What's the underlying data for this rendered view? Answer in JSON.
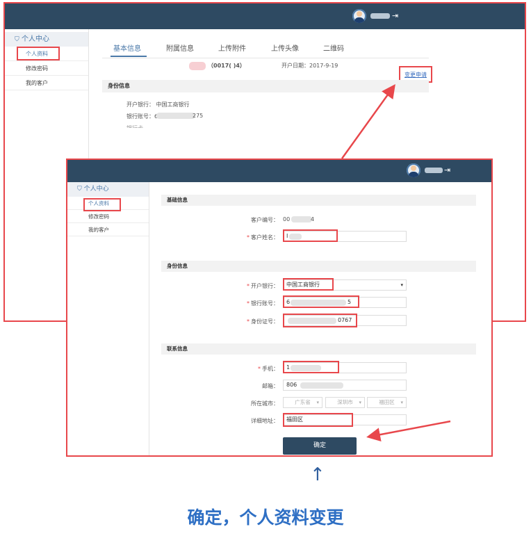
{
  "back_window": {
    "sidebar": {
      "section": "个人中心",
      "items": [
        {
          "label": "个人资料"
        },
        {
          "label": "修改密码"
        },
        {
          "label": "我的客户"
        }
      ]
    },
    "tabs": [
      {
        "label": "基本信息"
      },
      {
        "label": "附属信息"
      },
      {
        "label": "上传附件"
      },
      {
        "label": "上传头像"
      },
      {
        "label": "二维码"
      }
    ],
    "customer_code": "（0017(      )4）",
    "open_date": "开户日期：2017-9-19",
    "change_link": "变更申请",
    "section_title": "身份信息",
    "details": {
      "bank": "开户银行：  中国工商银行",
      "account_prefix": "银行账号：6",
      "account_suffix": "275",
      "truncated": "银行卡-"
    }
  },
  "front_window": {
    "sidebar": {
      "section": "个人中心",
      "items": [
        {
          "label": "个人资料"
        },
        {
          "label": "修改密码"
        },
        {
          "label": "我的客户"
        }
      ]
    },
    "sections": {
      "basic": "基础信息",
      "identity": "身份信息",
      "contact": "联系信息"
    },
    "form": {
      "customer_no_label": "客户编号：",
      "customer_no_prefix": "00",
      "customer_no_suffix": "4",
      "name_label": "客户姓名：",
      "name_value": "I",
      "bank_label": "开户银行：",
      "bank_value": "中国工商银行",
      "account_label": "银行账号：",
      "account_prefix": "6",
      "account_suffix": "5",
      "id_label": "身份证号：",
      "id_suffix": "0767",
      "phone_label": "手机：",
      "phone_prefix": "1",
      "email_label": "邮箱：",
      "email_prefix": "806",
      "city_label": "所在城市：",
      "province": "广东省",
      "city": "深圳市",
      "district": "福田区",
      "address_label": "详细地址：",
      "address_value": "福田区",
      "required_mark": "*"
    },
    "confirm_button": "确定"
  },
  "caption": "确定，个人资料变更",
  "icons": {
    "up_arrow": "↑",
    "logout": "⇥",
    "person": "⛉",
    "dropdown": "▾"
  },
  "colors": {
    "topbar": "#2e4a62",
    "highlight": "#e8474b",
    "accent": "#4a78a8",
    "caption": "#2e6fc4"
  }
}
